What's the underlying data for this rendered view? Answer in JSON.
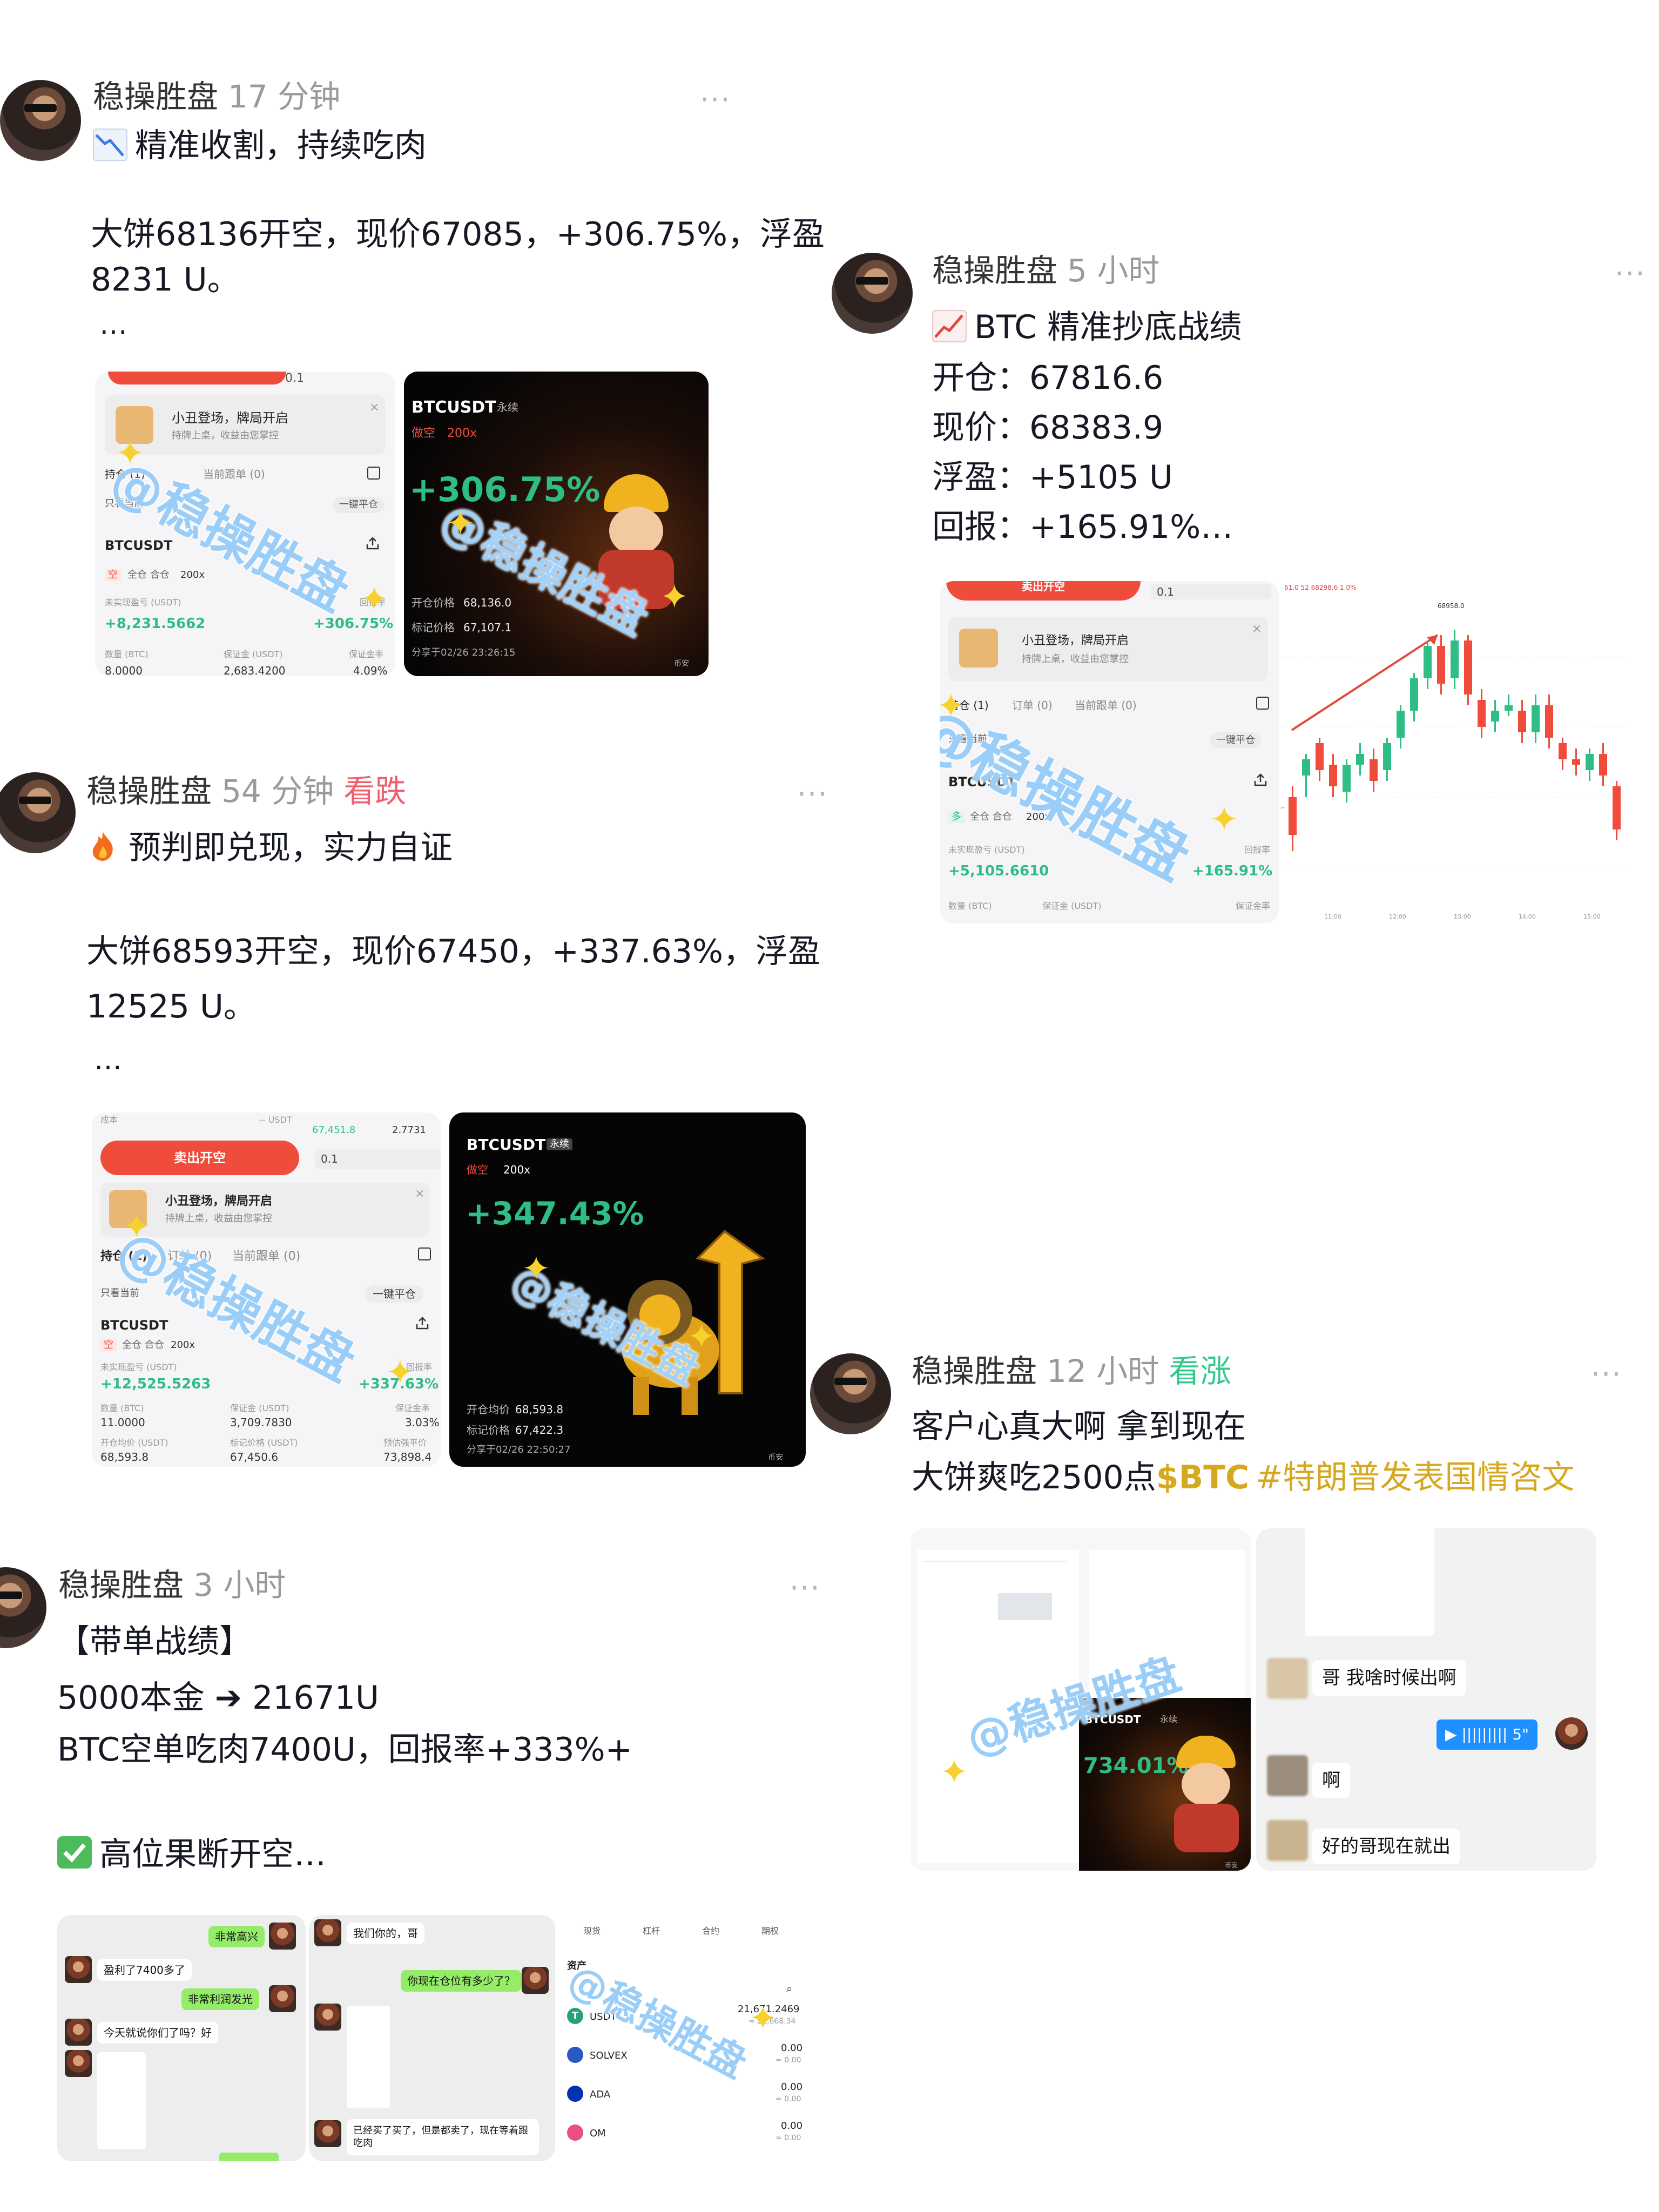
{
  "posts": [
    {
      "username": "稳操胜盘",
      "time": "17 分钟",
      "more": "···",
      "emoji": "chart-decreasing-icon",
      "headline": "精准收割，持续吃肉",
      "body": [
        "大饼68136开空，现价67085，+306.75%，浮盈",
        "8231 U。",
        "…"
      ],
      "img_left": {
        "amount_input": "0.1",
        "banner_title": "小丑登场，牌局开启",
        "banner_sub": "持牌上桌，收益由您掌控",
        "tab_positions": "持仓 (1)",
        "tab_plan": "当前跟单 (0)",
        "only_current": "只看当前",
        "close_all": "一键平仓",
        "symbol": "BTCUSDT",
        "side": "空",
        "mode": "全仓 合仓",
        "leverage": "200x",
        "pnl_label": "未实现盈亏 (USDT)",
        "roe_label": "回报率",
        "pnl": "+8,231.5662",
        "roe": "+306.75%",
        "size_label": "数量 (BTC)",
        "margin_label": "保证金 (USDT)",
        "ratio_label": "保证金率",
        "size": "8.0000",
        "margin": "2,683.4200",
        "ratio": "4.09%"
      },
      "img_right": {
        "symbol": "BTCUSDT",
        "perp": "永续",
        "side": "做空",
        "leverage": "200x",
        "roe": "+306.75%",
        "entry_label": "开仓价格",
        "entry": "68,136.0",
        "mark_label": "标记价格",
        "mark": "67,107.1",
        "shared": "分享于02/26 23:26:15",
        "exchange": "币安"
      },
      "watermark": "@稳操胜盘"
    },
    {
      "username": "稳操胜盘",
      "time": "54 分钟",
      "tag": "看跌",
      "more": "···",
      "emoji": "fire-icon",
      "headline": "预判即兑现，实力自证",
      "body": [
        "大饼68593开空，现价67450，+337.63%，浮盈",
        "12525 U。",
        "…"
      ],
      "img_left": {
        "cost_label": "成本",
        "cost_value": "-- USDT",
        "price1": "67,451.8",
        "price2": "2.7731",
        "sell_btn": "卖出开空",
        "amount_input": "0.1",
        "banner_title": "小丑登场，牌局开启",
        "banner_sub": "持牌上桌，收益由您掌控",
        "tab_positions": "持仓 (1)",
        "tab_orders": "订单 (0)",
        "tab_plan": "当前跟单 (0)",
        "only_current": "只看当前",
        "close_all": "一键平仓",
        "symbol": "BTCUSDT",
        "side": "空",
        "mode": "全仓 合仓",
        "leverage": "200x",
        "pnl_label": "未实现盈亏 (USDT)",
        "roe_label": "回报率",
        "pnl": "+12,525.5263",
        "roe": "+337.63%",
        "size_label": "数量 (BTC)",
        "margin_label": "保证金 (USDT)",
        "ratio_label": "保证金率",
        "size": "11.0000",
        "margin": "3,709.7830",
        "ratio": "3.03%",
        "entry_label": "开仓均价 (USDT)",
        "mark_label": "标记价格 (USDT)",
        "liq_label": "预估强平价",
        "entry": "68,593.8",
        "mark": "67,450.6",
        "liq": "73,898.4"
      },
      "img_right": {
        "symbol": "BTCUSDT",
        "perp": "永续",
        "side": "做空",
        "leverage": "200x",
        "roe": "+347.43%",
        "entry_label": "开仓均价",
        "entry": "68,593.8",
        "mark_label": "标记价格",
        "mark": "67,422.3",
        "shared": "分享于02/26 22:50:27",
        "exchange": "币安"
      },
      "watermark": "@稳操胜盘"
    },
    {
      "username": "稳操胜盘",
      "time": "3 小时",
      "more": "···",
      "lines": [
        "【带单战绩】",
        "5000本金 ➔ 21671U",
        "BTC空单吃肉7400U，回报率+333%+"
      ],
      "check_emoji": "check-mark-icon",
      "last_line": "高位果断开空…",
      "img1": {
        "b1": "非常高兴",
        "b2": "盈利了7400多了",
        "b3": "非常利润发光",
        "b4": "今天就说你们了吗？好"
      },
      "img2": {
        "b1": "我们你的，哥",
        "b2": "你现在仓位有多少了？",
        "b3": "已经买了买了，但是都卖了，现在等着跟吃肉"
      },
      "img3": {
        "tabs": [
          "现货",
          "杠杆",
          "合约",
          "期权"
        ],
        "section": "资产",
        "coins": [
          {
            "name": "USDT",
            "amount": "21,671.2469",
            "sub": "≈ 21,668.34"
          },
          {
            "name": "SOLVEX",
            "amount": "0.00",
            "sub": "≈ 0.00"
          },
          {
            "name": "ADA",
            "amount": "0.00",
            "sub": "≈ 0.00"
          },
          {
            "name": "OM",
            "amount": "0.00",
            "sub": "≈ 0.00"
          }
        ]
      },
      "watermark": "@稳操胜盘"
    },
    {
      "username": "稳操胜盘",
      "time": "5 小时",
      "more": "···",
      "emoji": "chart-increasing-icon",
      "lines": [
        "BTC 精准抄底战绩",
        "开仓：67816.6",
        "现价：68383.9",
        "浮盈：+5105 U",
        "回报：+165.91%…"
      ],
      "img_left": {
        "sell_btn": "卖出开空",
        "amount_input": "0.1",
        "banner_title": "小丑登场，牌局开启",
        "banner_sub": "持牌上桌，收益由您掌控",
        "tab_positions": "持仓 (1)",
        "tab_orders": "订单 (0)",
        "tab_plan": "当前跟单 (0)",
        "only_current": "只看当前",
        "close_all": "一键平仓",
        "symbol": "BTCUSDT",
        "side": "多",
        "mode": "全仓 合仓",
        "leverage": "200x",
        "pnl_label": "未实现盈亏 (USDT)",
        "roe_label": "回报率",
        "pnl": "+5,105.6610",
        "roe": "+165.91%",
        "size_label": "数量 (BTC)",
        "margin_label": "保证金 (USDT)",
        "ratio_label": "保证金率"
      },
      "img_right": {
        "top_label": "61.0 52 68298.6 1.0%",
        "peak_label": "68958.0",
        "times": [
          "11:00",
          "12:00",
          "13:00",
          "14:00",
          "15:00"
        ]
      },
      "watermark": "@稳操胜盘"
    },
    {
      "username": "稳操胜盘",
      "time": "12 小时",
      "tag": "看涨",
      "more": "···",
      "lines": [
        "客户心真大啊 拿到现在"
      ],
      "line2_plain": "大饼爽吃2500点",
      "line2_cashtag": "$BTC",
      "line2_hashtag": "#特朗普发表国情咨文",
      "img_left": {
        "roe": "734.01%",
        "symbol": "BTCUSDT",
        "perp": "永续",
        "exchange": "币安"
      },
      "img_right": {
        "b1": "哥 我啥时候出啊",
        "voice": "5\"",
        "b2": "啊",
        "b3": "好的哥现在就出"
      },
      "watermark": "@稳操胜盘"
    }
  ],
  "colors": {
    "profit_green": "#2ebd85",
    "loss_red": "#ef4c3c",
    "tag_red": "#ef5f6c",
    "tag_green": "#35c98e",
    "hashtag_gold": "#d6a81f",
    "watermark_blue": "#78bef5"
  }
}
